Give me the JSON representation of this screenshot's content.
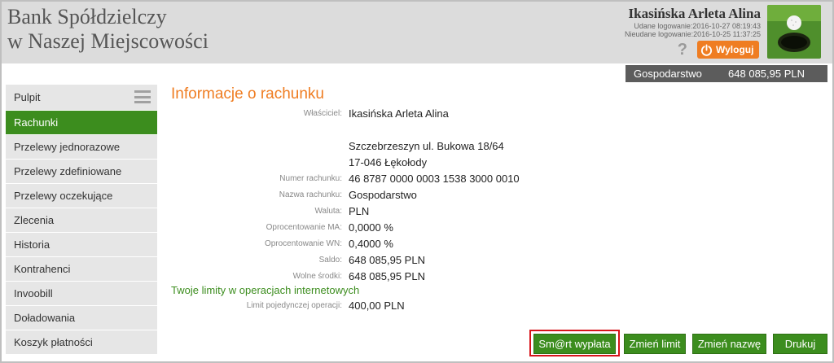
{
  "header": {
    "bank_name_line1": "Bank Spółdzielczy",
    "bank_name_line2": "w Naszej Miejscowości",
    "user_name": "Ikasińska Arleta Alina",
    "successful_login": "Udane logowanie:2016-10-27 08:19:43",
    "failed_login": "Nieudane logowanie:2016-10-25 11:37:25",
    "help_glyph": "?",
    "logout_label": "Wyloguj",
    "avatar_icon": "golf-ball-avatar-icon"
  },
  "balance_bar": {
    "account_name": "Gospodarstwo",
    "amount": "648 085,95 PLN"
  },
  "sidebar": {
    "items": [
      {
        "label": "Pulpit",
        "active": false
      },
      {
        "label": "Rachunki",
        "active": true
      },
      {
        "label": "Przelewy jednorazowe",
        "active": false
      },
      {
        "label": "Przelewy zdefiniowane",
        "active": false
      },
      {
        "label": "Przelewy oczekujące",
        "active": false
      },
      {
        "label": "Zlecenia",
        "active": false
      },
      {
        "label": "Historia",
        "active": false
      },
      {
        "label": "Kontrahenci",
        "active": false
      },
      {
        "label": "Invoobill",
        "active": false
      },
      {
        "label": "Doładowania",
        "active": false
      },
      {
        "label": "Koszyk płatności",
        "active": false
      }
    ]
  },
  "main": {
    "title": "Informacje o rachunku",
    "owner_label": "Właściciel:",
    "owner_value": "Ikasińska Arleta Alina",
    "address_line1": "Szczebrzeszyn ul. Bukowa 18/64",
    "address_line2": "17-046 Łękołody",
    "account_number_label": "Numer rachunku:",
    "account_number_value": "46 8787 0000 0003 1538 3000 0010",
    "account_name_label": "Nazwa rachunku:",
    "account_name_value": "Gospodarstwo",
    "currency_label": "Waluta:",
    "currency_value": "PLN",
    "interest_ma_label": "Oprocentowanie MA:",
    "interest_ma_value": "0,0000 %",
    "interest_wn_label": "Oprocentowanie WN:",
    "interest_wn_value": "0,4000 %",
    "balance_label": "Saldo:",
    "balance_value": "648 085,95 PLN",
    "available_label": "Wolne środki:",
    "available_value": "648 085,95 PLN",
    "limits_title": "Twoje limity w operacjach internetowych",
    "single_limit_label": "Limit pojedynczej operacji:",
    "single_limit_value": "400,00 PLN"
  },
  "buttons": {
    "smart_payout": "Sm@rt wypłata",
    "change_limit": "Zmień limit",
    "change_name": "Zmień nazwę",
    "print": "Drukuj"
  },
  "colors": {
    "accent_orange": "#ef7d22",
    "active_green": "#3c8d1e",
    "highlight_red": "#d7141a"
  }
}
